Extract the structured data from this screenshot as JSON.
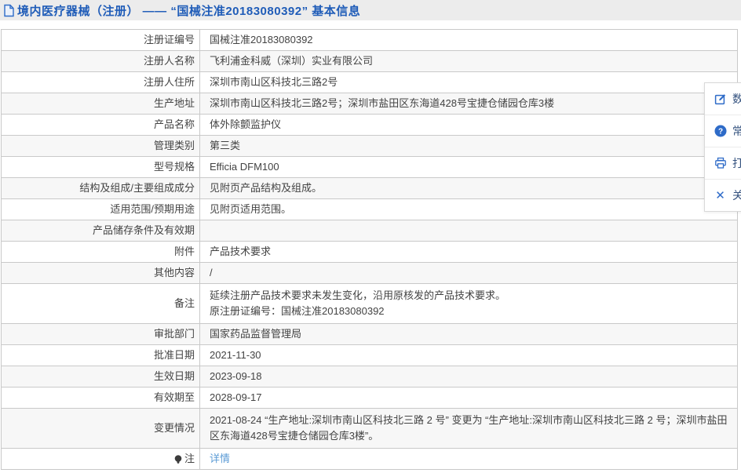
{
  "header": {
    "title": "境内医疗器械（注册） —— “国械注准20183080392” 基本信息"
  },
  "table": {
    "rows": [
      {
        "label": "注册证编号",
        "value": "国械注准20183080392"
      },
      {
        "label": "注册人名称",
        "value": "飞利浦金科威（深圳）实业有限公司"
      },
      {
        "label": "注册人住所",
        "value": "深圳市南山区科技北三路2号"
      },
      {
        "label": "生产地址",
        "value": "深圳市南山区科技北三路2号；深圳市盐田区东海道428号宝捷仓储园仓库3楼"
      },
      {
        "label": "产品名称",
        "value": "体外除颤监护仪"
      },
      {
        "label": "管理类别",
        "value": "第三类"
      },
      {
        "label": "型号规格",
        "value": "Efficia DFM100"
      },
      {
        "label": "结构及组成/主要组成成分",
        "value": "见附页产品结构及组成。"
      },
      {
        "label": "适用范围/预期用途",
        "value": "见附页适用范围。"
      },
      {
        "label": "产品储存条件及有效期",
        "value": ""
      },
      {
        "label": "附件",
        "value": "产品技术要求"
      },
      {
        "label": "其他内容",
        "value": "/"
      },
      {
        "label": "备注",
        "value": "延续注册产品技术要求未发生变化，沿用原核发的产品技术要求。\n原注册证编号：国械注准20183080392"
      },
      {
        "label": "审批部门",
        "value": "国家药品监督管理局"
      },
      {
        "label": "批准日期",
        "value": "2021-11-30"
      },
      {
        "label": "生效日期",
        "value": "2023-09-18"
      },
      {
        "label": "有效期至",
        "value": "2028-09-17"
      },
      {
        "label": "变更情况",
        "value": "2021-08-24 “生产地址:深圳市南山区科技北三路 2 号” 变更为 “生产地址:深圳市南山区科技北三路 2 号；深圳市盐田区东海道428号宝捷仓储园仓库3楼”。"
      },
      {
        "label": "注",
        "value": "详情"
      }
    ]
  },
  "side_panel": {
    "items": [
      {
        "icon": "edit-icon",
        "label": "数据纠错"
      },
      {
        "icon": "question-icon",
        "label": "常见问题"
      },
      {
        "icon": "printer-icon",
        "label": "打印"
      },
      {
        "icon": "close-icon",
        "label": "关闭"
      }
    ]
  },
  "colors": {
    "accent_blue": "#1f5cb8",
    "link_blue": "#5b9bd5",
    "panel_icon_blue": "#2e6bc8",
    "stripe_gray": "#f7f7f7",
    "border_gray": "#c9c9c9"
  }
}
